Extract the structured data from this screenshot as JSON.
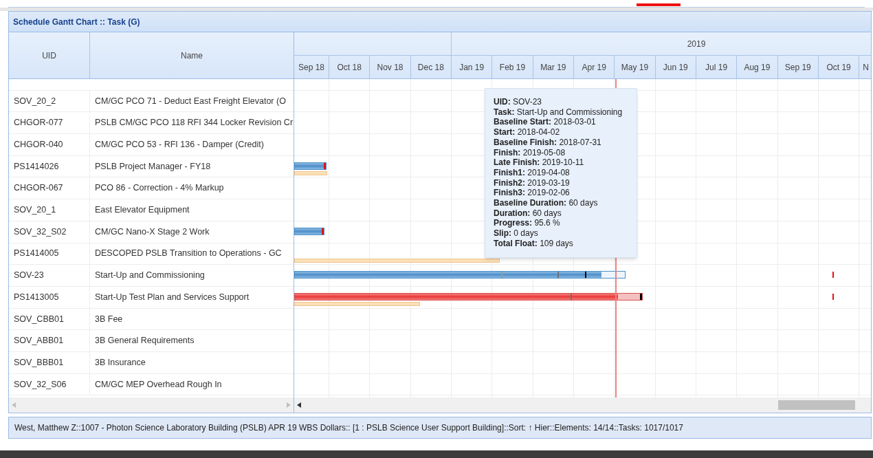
{
  "panel": {
    "title": "Schedule Gantt Chart :: Task (G)"
  },
  "columns": [
    {
      "label": "UID"
    },
    {
      "label": "Name"
    }
  ],
  "timeline": {
    "years": [
      "2019"
    ],
    "months": [
      "Sep 18",
      "Oct 18",
      "Nov 18",
      "Dec 18",
      "Jan 19",
      "Feb 19",
      "Mar 19",
      "Apr 19",
      "May 19",
      "Jun 19",
      "Jul 19",
      "Aug 19",
      "Sep 19",
      "Oct 19",
      "N"
    ]
  },
  "rows": [
    {
      "uid": "SOV_20_2",
      "name": "CM/GC PCO 71 - Deduct East Freight Elevator (O",
      "selected": false
    },
    {
      "uid": "CHGOR-077",
      "name": "PSLB CM/GC PCO 118 RFI 344 Locker Revision Cr",
      "selected": false
    },
    {
      "uid": "CHGOR-040",
      "name": "CM/GC PCO 53 - RFI 136 - Damper (Credit)",
      "selected": false
    },
    {
      "uid": "PS1414026",
      "name": "PSLB Project Manager - FY18",
      "selected": false,
      "bar": {
        "kind": "task",
        "level": 1
      },
      "baseline": true
    },
    {
      "uid": "CHGOR-067",
      "name": "PCO 86 - Correction - 4% Markup",
      "selected": false
    },
    {
      "uid": "SOV_20_1",
      "name": "East Elevator Equipment",
      "selected": false
    },
    {
      "uid": "SOV_32_S02",
      "name": "CM/GC Nano-X Stage 2 Work",
      "selected": false,
      "bar": {
        "kind": "task",
        "level": 1
      }
    },
    {
      "uid": "PS1414005",
      "name": "DESCOPED PSLB Transition to Operations - GC",
      "selected": false,
      "baseline": true
    },
    {
      "uid": "SOV-23",
      "name": "Start-Up and Commissioning",
      "selected": false,
      "bar": {
        "kind": "task",
        "level": 0.93
      }
    },
    {
      "uid": "PS1413005",
      "name": "Start-Up Test Plan and Services Support",
      "selected": false,
      "bar": {
        "kind": "critical",
        "level": 0.93
      },
      "baseline": true
    },
    {
      "uid": "SOV_CBB01",
      "name": "3B Fee",
      "selected": false
    },
    {
      "uid": "SOV_ABB01",
      "name": "3B General Requirements",
      "selected": false
    },
    {
      "uid": "SOV_BBB01",
      "name": "3B Insurance",
      "selected": false
    },
    {
      "uid": "SOV_32_S06",
      "name": "CM/GC MEP Overhead Rough In",
      "selected": false
    }
  ],
  "tooltip": {
    "lines": [
      {
        "label": "UID:",
        "value": "SOV-23"
      },
      {
        "label": "Task:",
        "value": "Start-Up and Commissioning"
      },
      {
        "label": "Baseline Start:",
        "value": "2018-03-01"
      },
      {
        "label": "Start:",
        "value": "2018-04-02"
      },
      {
        "label": "Baseline Finish:",
        "value": "2018-07-31"
      },
      {
        "label": "Finish:",
        "value": "2019-05-08"
      },
      {
        "label": "Late Finish:",
        "value": "2019-10-11"
      },
      {
        "label": "Finish1:",
        "value": "2019-04-08"
      },
      {
        "label": "Finish2:",
        "value": "2019-03-19"
      },
      {
        "label": "Finish3:",
        "value": "2019-02-06"
      },
      {
        "label": "Baseline Duration:",
        "value": "60 days"
      },
      {
        "label": "Duration:",
        "value": "60 days"
      },
      {
        "label": "Progress:",
        "value": "95.6 %"
      },
      {
        "label": "Slip:",
        "value": "0 days"
      },
      {
        "label": "Total Float:",
        "value": "109 days"
      }
    ]
  },
  "status_bar": "West, Matthew Z::1007 - Photon Science Laboratory Building (PSLB) APR 19 WBS Dollars:: [1 : PSLB Science User Support Building]::Sort: ↑ Hier::Elements: 14/14::Tasks: 1017/1017"
}
